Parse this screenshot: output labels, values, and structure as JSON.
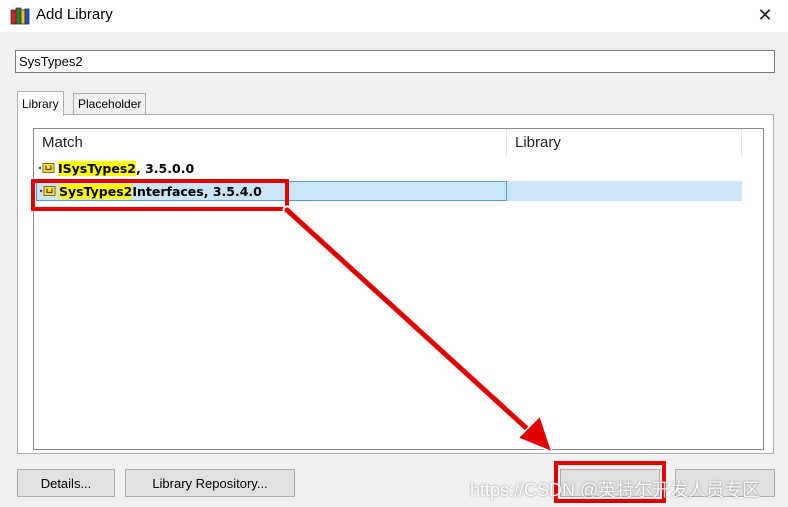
{
  "window": {
    "title": "Add Library"
  },
  "search": {
    "value": "SysTypes2"
  },
  "tabs": [
    {
      "label": "Library"
    },
    {
      "label": "Placeholder"
    }
  ],
  "list": {
    "columns": [
      "Match",
      "Library"
    ],
    "rows": [
      {
        "match_prefix": "",
        "match_highlight": "ISysTypes2",
        "match_suffix": ", 3.5.0.0",
        "library": "",
        "selected": false
      },
      {
        "match_prefix": "",
        "match_highlight": "SysTypes2",
        "match_suffix": " Interfaces, 3.5.4.0",
        "library": "",
        "selected": true
      }
    ]
  },
  "buttons": {
    "details": "Details...",
    "repository": "Library Repository...",
    "ok": "",
    "cancel": ""
  },
  "watermark": "https://CSDN @英特尔开发人员专区",
  "icons": {
    "app": "library-books-icon",
    "close": "close-icon",
    "row": "library-package-icon"
  },
  "colors": {
    "highlight": "#ffff00",
    "selection": "#cce4f7",
    "annotation": "#e00000"
  }
}
